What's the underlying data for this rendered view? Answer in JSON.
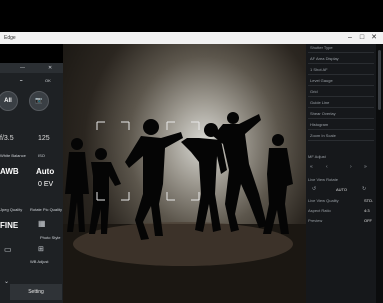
{
  "window": {
    "title": "Edge"
  },
  "left_panel": {
    "mode_auto_label": "All",
    "aperture": "f/3.5",
    "iso": "125",
    "label_white_balance": "White Balance",
    "label_iso": "ISO",
    "white_balance": "AWB",
    "drive_value": "Auto",
    "exposure_comp": "0 EV",
    "label_jpeg_quality": "Jpeg Quality",
    "label_rotate": "Rotate Pic Quality",
    "jpeg_quality": "FINE",
    "label_photo_style": "Photo Style",
    "label_wb_adjust": "WB Adjust",
    "setting_button": "Setting"
  },
  "right_panel": {
    "items": [
      "Shutter Type",
      "AF Area Display",
      "1 Shot AF",
      "Level Gauge",
      "Grid",
      "Guide Line",
      "Shear Overlay",
      "Histogram",
      "Zoom In Scale"
    ],
    "mf_adjust_label": "MF Adjust",
    "live_view_rotate_label": "Live View Rotate",
    "rotate_value": "AUTO",
    "live_view_quality_label": "Live View Quality",
    "live_view_quality_value": "STD.",
    "aspect_ratio_label": "Aspect Ratio",
    "aspect_ratio_value": "4:3",
    "preview_label": "Preview",
    "preview_value": "OFF"
  }
}
